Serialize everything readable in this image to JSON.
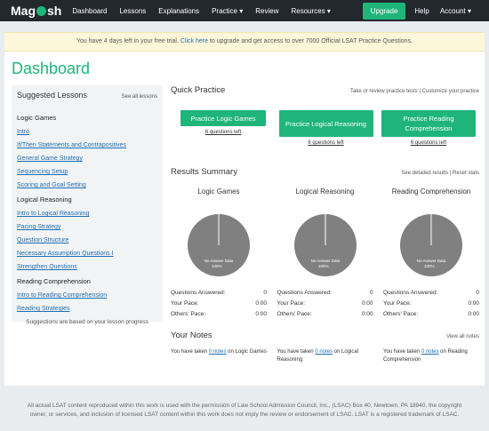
{
  "nav": {
    "logo_left": "Mag",
    "logo_right": "sh",
    "items": [
      "Dashboard",
      "Lessons",
      "Explanations",
      "Practice ▾",
      "Review",
      "Resources ▾"
    ],
    "upgrade": "Upgrade",
    "help": "Help",
    "account": "Account ▾"
  },
  "banner": {
    "before": "You have 4 days left in your free trial. ",
    "link": "Click here",
    "after": " to upgrade and get access to over 7000 Official LSAT Practice Questions."
  },
  "page_title": "Dashboard",
  "sidebar": {
    "title": "Suggested Lessons",
    "see_all": "See all lessons",
    "categories": [
      {
        "name": "Logic Games",
        "lessons": [
          "Intro",
          "If/Then Statements and Contrapositives",
          "General Game Strategy",
          "Sequencing Setup",
          "Scoring and Goal Setting"
        ]
      },
      {
        "name": "Logical Reasoning",
        "lessons": [
          "Intro to Logical Reasoning",
          "Pacing Strategy",
          "Question Structure",
          "Necessary Assumption Questions I",
          "Strengthen Questions"
        ]
      },
      {
        "name": "Reading Comprehension",
        "lessons": [
          "Intro to Reading Comprehension",
          "Reading Strategies"
        ]
      }
    ],
    "footer": "Suggestions are based on your lesson progress"
  },
  "quick_practice": {
    "title": "Quick Practice",
    "links": "Take or review practice tests | Customize your practice",
    "buttons": [
      {
        "label": "Practice Logic Games",
        "left": "6 questions left"
      },
      {
        "label": "Practice Logical Reasoning",
        "left": "6 questions left"
      },
      {
        "label": "Practice Reading Comprehension",
        "left": "6 questions left"
      }
    ]
  },
  "results": {
    "title": "Results Summary",
    "links": "See detailed results | Reset stats",
    "pie_label_1": "No Answer Data",
    "pie_label_2": "100%",
    "pie_color": "#808080",
    "stat_labels": [
      "Questions Answered:",
      "Your Pace:",
      "Others' Pace:"
    ],
    "columns": [
      {
        "title": "Logic Games",
        "answered": "0",
        "pace": "0:00",
        "others": "0:00"
      },
      {
        "title": "Logical Reasoning",
        "answered": "0",
        "pace": "0:00",
        "others": "0:00"
      },
      {
        "title": "Reading Comprehension",
        "answered": "0",
        "pace": "0:00",
        "others": "0:00"
      }
    ]
  },
  "notes": {
    "title": "Your Notes",
    "view_all": "View all notes",
    "items": [
      {
        "before": "You have taken ",
        "link": "0 notes",
        "after": " on Logic Games"
      },
      {
        "before": "You have taken ",
        "link": "0 notes",
        "after": " on Logical Reasoning"
      },
      {
        "before": "You have taken ",
        "link": "0 notes",
        "after": " on Reading Comprehension"
      }
    ]
  },
  "footer": "All actual LSAT content reproduced within this work is used with the permission of Law School Admission Council, Inc., (LSAC) Box 40, Newtown, PA 18940, the copyright owner, or services, and inclusion of licensed LSAT content within this work does not imply the review or endorsement of LSAC. LSAT is a registered trademark of LSAC.",
  "colors": {
    "accent": "#1fb57a",
    "nav_bg": "#23282d",
    "banner_bg": "#fdf7d9",
    "link": "#1f6fb0"
  }
}
